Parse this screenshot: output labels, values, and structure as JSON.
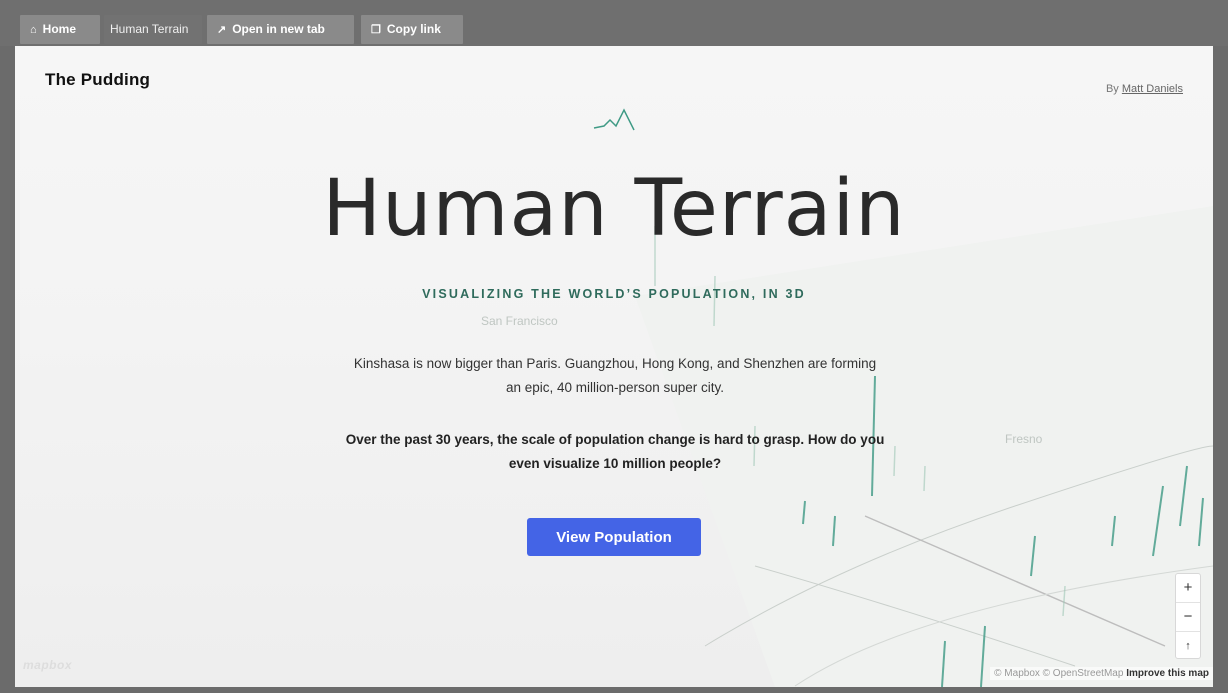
{
  "toolbar": {
    "home": "Home",
    "crumb": "Human Terrain",
    "open_new_tab": "Open in new tab",
    "copy_link": "Copy link"
  },
  "page": {
    "brand": "The Pudding",
    "byline_prefix": "By ",
    "byline_author": "Matt Daniels",
    "title": "Human Terrain",
    "subtitle": "VISUALIZING THE WORLD’S POPULATION, IN 3D",
    "para1": "Kinshasa is now bigger than Paris.  Guangzhou, Hong Kong, and Shenzhen are  forming an epic, 40 million-person super city.",
    "para2": "Over the past 30 years, the scale of population change is hard to grasp. How do you even visualize 10 million people?",
    "cta": "View Population"
  },
  "map": {
    "label_sf": "San Francisco",
    "label_fresno": "Fresno",
    "zoom_in": "+",
    "zoom_out": "−",
    "compass": "↑",
    "mapbox_logo": "mapbox",
    "attribution": "© Mapbox © OpenStreetMap",
    "improve": "Improve this map"
  },
  "colors": {
    "accent": "#4464e6",
    "subtitle": "#2f6b5c",
    "spike": "#3f9a85"
  },
  "icons": {
    "home": "home-icon",
    "open": "external-link-icon",
    "copy": "copy-icon"
  }
}
